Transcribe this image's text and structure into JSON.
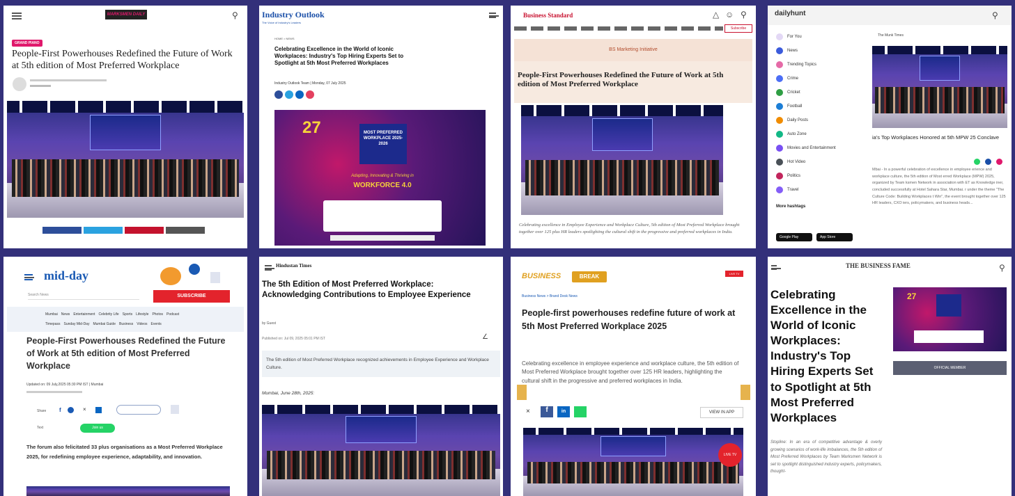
{
  "p1": {
    "logo": "MARKSMEN DAILY",
    "badge": "GRAND PIANO",
    "headline": "People-First Powerhouses Redefined the Future of Work at 5th edition of Most Preferred Workplace"
  },
  "p2": {
    "logo": "Industry Outlook",
    "logo_sub": "The Voice of Industry's Leaders",
    "kicker": "HOME > NEWS",
    "headline": "Celebrating Excellence in the World of Iconic Workplaces: Industry's Top Hiring Experts Set to Spotlight at 5th Most Preferred Workplaces",
    "byline": "Industry Outlook Team | Monday, 07 July 2025",
    "poster_date": "27",
    "poster_box": "MOST PREFERRED WORKPLACE 2025-2026",
    "poster_tagline": "Adapting, Innovating & Thriving in",
    "poster_workforce": "WORKFORCE 4.0"
  },
  "p3": {
    "logo": "Business Standard",
    "banner": "BS Marketing Initiative",
    "headline": "People-First Powerhouses Redefined the Future of Work at 5th edition of Most Preferred Workplace",
    "caption": "Celebrating excellence in Employee Experience and Workplace Culture, 5th edition of Most Preferred Workplace brought together over 125 plus HR leaders spotlighting the cultural shift in the progressive and preferred workplaces in India."
  },
  "p4": {
    "logo": "dailyhunt",
    "menu": [
      "For You",
      "News",
      "Trending Topics",
      "Crime",
      "Cricket",
      "Football",
      "Daily Posts",
      "Auto Zone",
      "Movies and Entertainment",
      "Hot Video",
      "Politics",
      "Travel"
    ],
    "more": "More hashtags",
    "source": "The Munk Times",
    "headline": "ia's Top Workplaces Honored at 5th MPW 25 Conclave",
    "body": "Mbai - In a powerful celebration of excellence in employee erience and workplace culture, the 5th edition of Most erred Workplace (MPW) 2025, organized by Team ksmen Network in association with ET as Knowledge iner, concluded successfully at Hotel Sahara Star, Mumbai. r under the theme \"The Culture Code: Building Workplaces t Win\", the event brought together over 125 HR leaders, CXO iers, policymakers, and business heads...",
    "google_play": "Google Play",
    "app_store": "App Store"
  },
  "p5": {
    "logo": "mid-day",
    "search_placeholder": "Search News",
    "subscribe": "SUBSCRIBE",
    "nav1": [
      "Mumbai",
      "News",
      "Entertainment",
      "Celebrity Life",
      "Sports",
      "Lifestyle",
      "Photos",
      "Podcast"
    ],
    "nav2": [
      "Timepass",
      "Sunday Mid-Day",
      "Mumbai Guide",
      "Business",
      "Videos",
      "Events"
    ],
    "headline": "People-First Powerhouses Redefined the Future of Work at 5th edition of Most Preferred Workplace",
    "updated": "Updated on: 09 July,2025 05:30 PM IST | Mumbai",
    "share_label": "Share",
    "text_label": "Text",
    "join_label": "Join us",
    "intro": "The forum also felicitated 33 plus organisations as a Most Preferred Workplace 2025, for redefining employee experience, adaptability, and innovation."
  },
  "p6": {
    "logo": "Hindustan Times",
    "headline": "The 5th Edition of Most Preferred Workplace: Acknowledging Contributions to Employee Experience",
    "author": "by Guest",
    "published": "Published on: Jul 09, 2025 05:01 PM IST",
    "summary": "The 5th edition of Most Preferred Workplace recognized achievements in Employee Experience and Workplace Culture.",
    "dateline": "Mumbai, June 28th, 2025:"
  },
  "p7": {
    "logo": "BUSINESS",
    "logo_badge": "BREAK",
    "breadcrumb": "Business News > Brand Desk News",
    "headline": "People-first powerhouses redefine future of work at 5th Most Preferred Workplace 2025",
    "summary": "Celebrating excellence in employee experience and workplace culture, the 5th edition of Most Preferred Workplace brought together over 125 HR leaders, highlighting the cultural shift in the progressive and preferred workplaces in India.",
    "view_in_app": "VIEW IN APP",
    "live": "LIVE TV"
  },
  "p8": {
    "logo": "THE BUSINESS FAME",
    "headline": "Celebrating Excellence in the World of Iconic Workplaces: Industry's Top Hiring Experts Set to Spotlight at 5th Most Preferred Workplaces",
    "official": "OFFICIAL MEMBER",
    "intro": "Stopline: In an era of competitive advantage & overly growing scenarios of work-life imbalances, the 5th edition of Most Preferred Workplaces by Team Marksmen Network is set to spotlight distinguished industry experts, policymakers, thought-"
  },
  "colors": {
    "background": "#33307a",
    "accent_pink": "#e0186c",
    "bs_red": "#c8102e",
    "midday_blue": "#1a5ab4"
  }
}
